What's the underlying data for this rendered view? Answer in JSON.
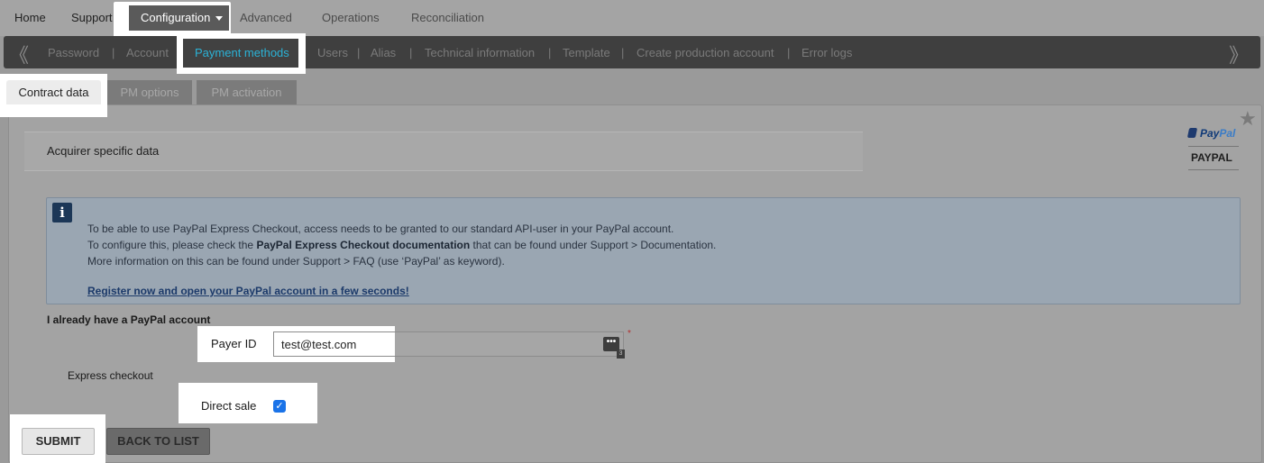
{
  "topnav": {
    "items": [
      "Home",
      "Support",
      "Advanced",
      "Operations",
      "Reconciliation"
    ],
    "active": "Configuration"
  },
  "subnav": {
    "items": [
      "Password",
      "Account",
      "Payment methods",
      "Users",
      "Alias",
      "Technical information",
      "Template",
      "Create production account",
      "Error logs"
    ],
    "left_arrow": "《",
    "right_arrow": "》",
    "separator": "|"
  },
  "tabs": [
    "Contract data",
    "PM options",
    "PM activation"
  ],
  "section": {
    "title": "Acquirer specific data",
    "logo": {
      "brand_pay": "Pay",
      "brand_pal": "Pal",
      "name": "PAYPAL"
    }
  },
  "info": {
    "icon_glyph": "i",
    "line1": "To be able to use PayPal Express Checkout, access needs to be granted to our standard API-user in your PayPal account.",
    "line2_prefix": "To configure this, please check the ",
    "line2_bold": "PayPal Express Checkout documentation",
    "line2_suffix": " that can be found under Support > Documentation.",
    "line3": "More information on this can be found under Support > FAQ (use ‘PayPal’ as keyword).",
    "link": "Register now and open your PayPal account in a few seconds!"
  },
  "form": {
    "already_label": "I already have a PayPal account",
    "payer_id_label": "Payer ID",
    "payer_id_value": "test@test.com",
    "payer_dots": "•••",
    "payer_count": "3",
    "required_mark": "*",
    "express_label": "Express checkout",
    "direct_sale_label": "Direct sale",
    "direct_sale_checked": true,
    "check_glyph": "✓"
  },
  "buttons": {
    "submit": "SUBMIT",
    "back": "BACK TO LIST"
  },
  "colors": {
    "link_active": "#2bb2d6",
    "checkbox": "#1a73e8",
    "info_bg": "#9aa6b2"
  }
}
